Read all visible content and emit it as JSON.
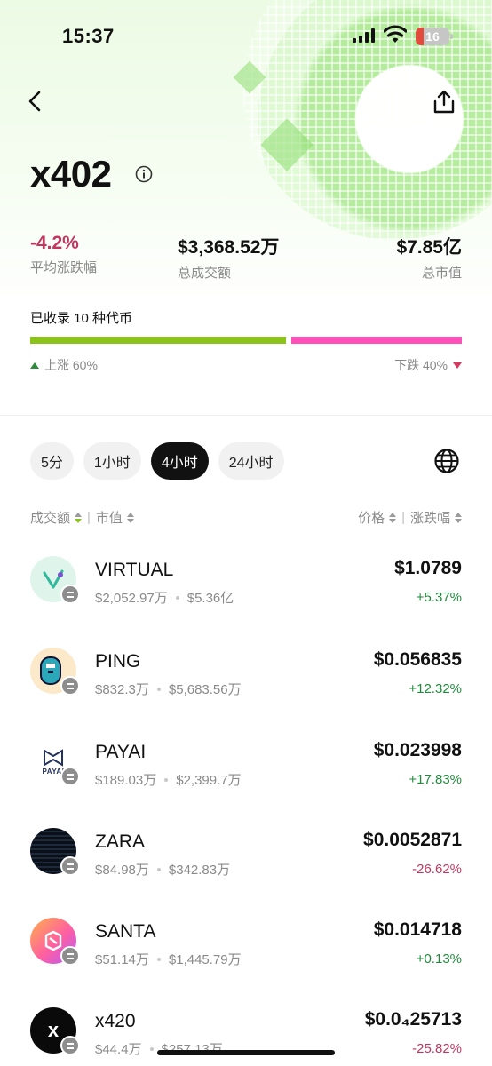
{
  "status_bar": {
    "time": "15:37",
    "battery": "16"
  },
  "header": {
    "title": "x402"
  },
  "stats": [
    {
      "value": "-4.2%",
      "label": "平均涨跌幅"
    },
    {
      "value": "$3,368.52万",
      "label": "总成交额"
    },
    {
      "value": "$7.85亿",
      "label": "总市值"
    }
  ],
  "coverage": {
    "text": "已收录 10 种代币",
    "up_label": "上涨 60%",
    "down_label": "下跌 40%",
    "up_fraction": 0.6,
    "colors": {
      "up": "#8cc31b",
      "down": "#ff4fb8"
    }
  },
  "tabs": [
    {
      "label": "5分",
      "active": false
    },
    {
      "label": "1小时",
      "active": false
    },
    {
      "label": "4小时",
      "active": true
    },
    {
      "label": "24小时",
      "active": false
    }
  ],
  "sort": {
    "volume": "成交额",
    "mcap": "市值",
    "price": "价格",
    "change": "涨跌幅"
  },
  "tokens": [
    {
      "symbol": "VIRTUAL",
      "volume": "$2,052.97万",
      "mcap": "$5.36亿",
      "price": "$1.0789",
      "change": "+5.37%",
      "direction": "up",
      "icon": "virtual-logo-icon",
      "chain": "base-chain-icon"
    },
    {
      "symbol": "PING",
      "volume": "$832.3万",
      "mcap": "$5,683.56万",
      "price": "$0.056835",
      "change": "+12.32%",
      "direction": "up",
      "icon": "ping-logo-icon",
      "chain": "base-chain-icon"
    },
    {
      "symbol": "PAYAI",
      "volume": "$189.03万",
      "mcap": "$2,399.7万",
      "price": "$0.023998",
      "change": "+17.83%",
      "direction": "up",
      "icon": "payai-logo-icon",
      "icon_text": "PAYAI",
      "chain": "solana-chain-icon"
    },
    {
      "symbol": "ZARA",
      "volume": "$84.98万",
      "mcap": "$342.83万",
      "price": "$0.0052871",
      "change": "-26.62%",
      "direction": "down",
      "icon": "zara-logo-icon",
      "chain": "solana-chain-icon"
    },
    {
      "symbol": "SANTA",
      "volume": "$51.14万",
      "mcap": "$1,445.79万",
      "price": "$0.014718",
      "change": "+0.13%",
      "direction": "up",
      "icon": "santa-logo-icon",
      "chain": "base-chain-icon"
    },
    {
      "symbol": "x420",
      "volume": "$44.4万",
      "mcap": "$257.13万",
      "price": "$0.0₄25713",
      "change": "-25.82%",
      "direction": "down",
      "icon": "x420-logo-icon",
      "icon_text": "x",
      "chain": "base-chain-icon"
    }
  ]
}
